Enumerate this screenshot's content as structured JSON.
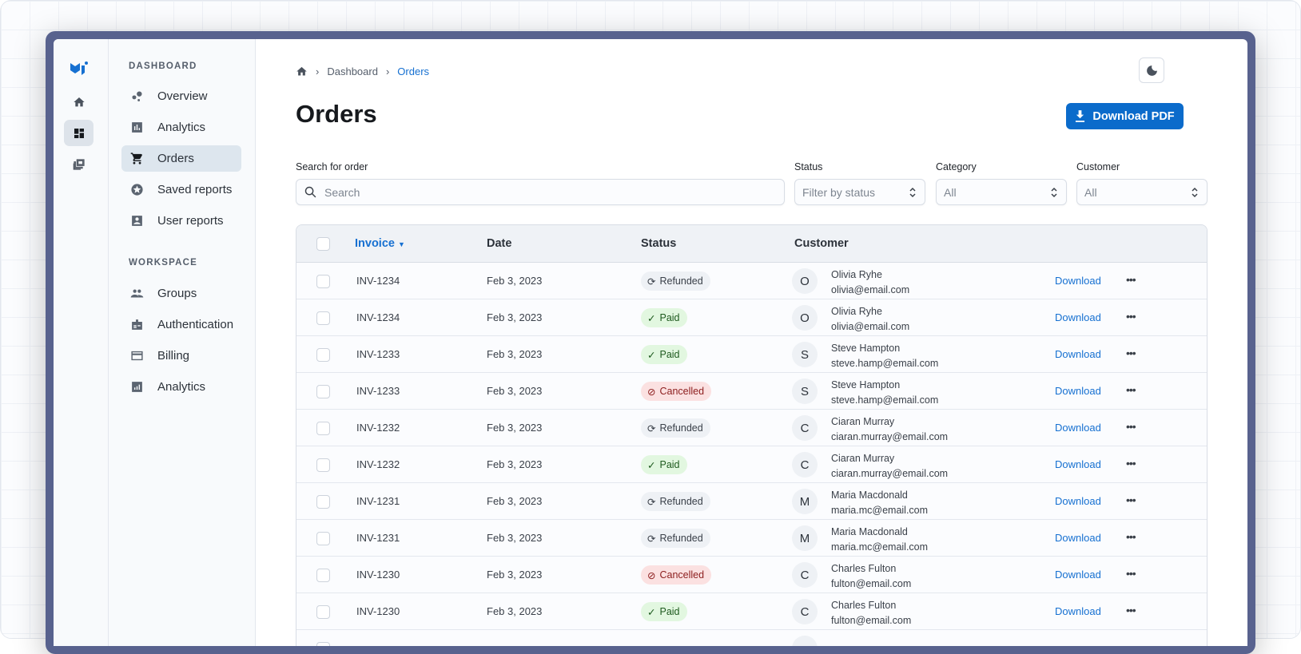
{
  "breadcrumb": {
    "home_icon": "home-icon",
    "items": [
      "Dashboard",
      "Orders"
    ]
  },
  "page": {
    "title": "Orders",
    "download_pdf": "Download PDF",
    "theme_toggle_icon": "moon-icon"
  },
  "sidebar": {
    "sections": [
      {
        "header": "DASHBOARD",
        "items": [
          {
            "label": "Overview",
            "icon": "bubble-chart-icon"
          },
          {
            "label": "Analytics",
            "icon": "bar-chart-icon"
          },
          {
            "label": "Orders",
            "icon": "cart-icon",
            "active": true
          },
          {
            "label": "Saved reports",
            "icon": "star-icon"
          },
          {
            "label": "User reports",
            "icon": "account-box-icon"
          }
        ]
      },
      {
        "header": "WORKSPACE",
        "items": [
          {
            "label": "Groups",
            "icon": "group-icon"
          },
          {
            "label": "Authentication",
            "icon": "badge-icon"
          },
          {
            "label": "Billing",
            "icon": "credit-card-icon"
          },
          {
            "label": "Analytics",
            "icon": "analytics-icon"
          }
        ]
      }
    ]
  },
  "filters": {
    "search_label": "Search for order",
    "search_placeholder": "Search",
    "status_label": "Status",
    "status_value": "Filter by status",
    "category_label": "Category",
    "category_value": "All",
    "customer_label": "Customer",
    "customer_value": "All"
  },
  "table": {
    "columns": [
      "Invoice",
      "Date",
      "Status",
      "Customer"
    ],
    "action_label": "Download",
    "rows": [
      {
        "invoice": "INV-1234",
        "date": "Feb 3, 2023",
        "status": "Refunded",
        "initial": "O",
        "name": "Olivia Ryhe",
        "email": "olivia@email.com"
      },
      {
        "invoice": "INV-1234",
        "date": "Feb 3, 2023",
        "status": "Paid",
        "initial": "O",
        "name": "Olivia Ryhe",
        "email": "olivia@email.com"
      },
      {
        "invoice": "INV-1233",
        "date": "Feb 3, 2023",
        "status": "Paid",
        "initial": "S",
        "name": "Steve Hampton",
        "email": "steve.hamp@email.com"
      },
      {
        "invoice": "INV-1233",
        "date": "Feb 3, 2023",
        "status": "Cancelled",
        "initial": "S",
        "name": "Steve Hampton",
        "email": "steve.hamp@email.com"
      },
      {
        "invoice": "INV-1232",
        "date": "Feb 3, 2023",
        "status": "Refunded",
        "initial": "C",
        "name": "Ciaran Murray",
        "email": "ciaran.murray@email.com"
      },
      {
        "invoice": "INV-1232",
        "date": "Feb 3, 2023",
        "status": "Paid",
        "initial": "C",
        "name": "Ciaran Murray",
        "email": "ciaran.murray@email.com"
      },
      {
        "invoice": "INV-1231",
        "date": "Feb 3, 2023",
        "status": "Refunded",
        "initial": "M",
        "name": "Maria Macdonald",
        "email": "maria.mc@email.com"
      },
      {
        "invoice": "INV-1231",
        "date": "Feb 3, 2023",
        "status": "Refunded",
        "initial": "M",
        "name": "Maria Macdonald",
        "email": "maria.mc@email.com"
      },
      {
        "invoice": "INV-1230",
        "date": "Feb 3, 2023",
        "status": "Cancelled",
        "initial": "C",
        "name": "Charles Fulton",
        "email": "fulton@email.com"
      },
      {
        "invoice": "INV-1230",
        "date": "Feb 3, 2023",
        "status": "Paid",
        "initial": "C",
        "name": "Charles Fulton",
        "email": "fulton@email.com"
      }
    ]
  },
  "colors": {
    "primary": "#0b6bcb",
    "frame": "#58628e",
    "paid_bg": "#e2f7e0",
    "cancelled_bg": "#fbe1e1",
    "refunded_bg": "#eef1f5"
  }
}
